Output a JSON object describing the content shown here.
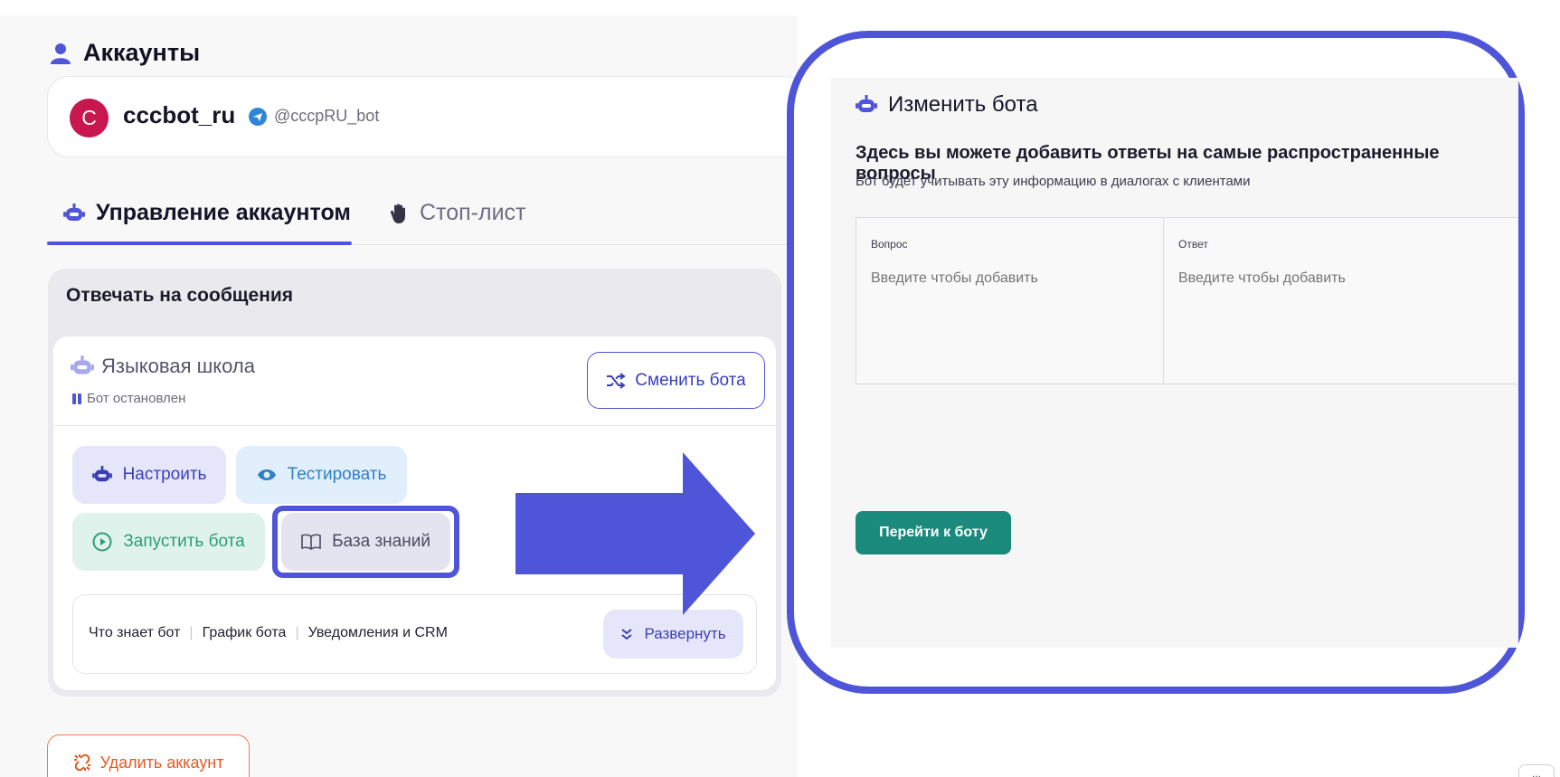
{
  "colors": {
    "accent": "#4f55d8",
    "success": "#2e9b78",
    "danger": "#e45a25",
    "teal_button": "#1a8a7c",
    "avatar": "#c8174f"
  },
  "header": {
    "section_title": "Аккаунты",
    "icon": "user-icon"
  },
  "account": {
    "avatar_letter": "C",
    "name": "cccbot_ru",
    "handle": "@cccpRU_bot",
    "handle_icon": "telegram-icon"
  },
  "tabs": [
    {
      "label": "Управление аккаунтом",
      "icon": "bot-icon",
      "active": true
    },
    {
      "label": "Стоп-лист",
      "icon": "hand-icon",
      "active": false
    }
  ],
  "reply_section": {
    "title": "Отвечать на сообщения",
    "bot_name": "Языковая школа",
    "bot_status": "Бот остановлен",
    "switch_button": "Сменить бота",
    "actions": {
      "setup": "Настроить",
      "test": "Тестировать",
      "run": "Запустить бота",
      "knowledge_base": "База знаний"
    },
    "features": [
      "Что знает бот",
      "График бота",
      "Уведомления и CRM"
    ],
    "feature_separator": "|",
    "expand_button": "Развернуть"
  },
  "delete_button": "Удалить аккаунт",
  "edit_panel": {
    "title": "Изменить бота",
    "heading": "Здесь вы можете добавить ответы на самые распространенные вопросы",
    "subtitle": "Бот будет учитывать эту информацию в диалогах с клиентами",
    "question_label": "Вопрос",
    "answer_label": "Ответ",
    "question_placeholder": "Введите чтобы добавить",
    "answer_placeholder": "Введите чтобы добавить",
    "goto_button": "Перейти к боту"
  },
  "corner_chip": "..."
}
